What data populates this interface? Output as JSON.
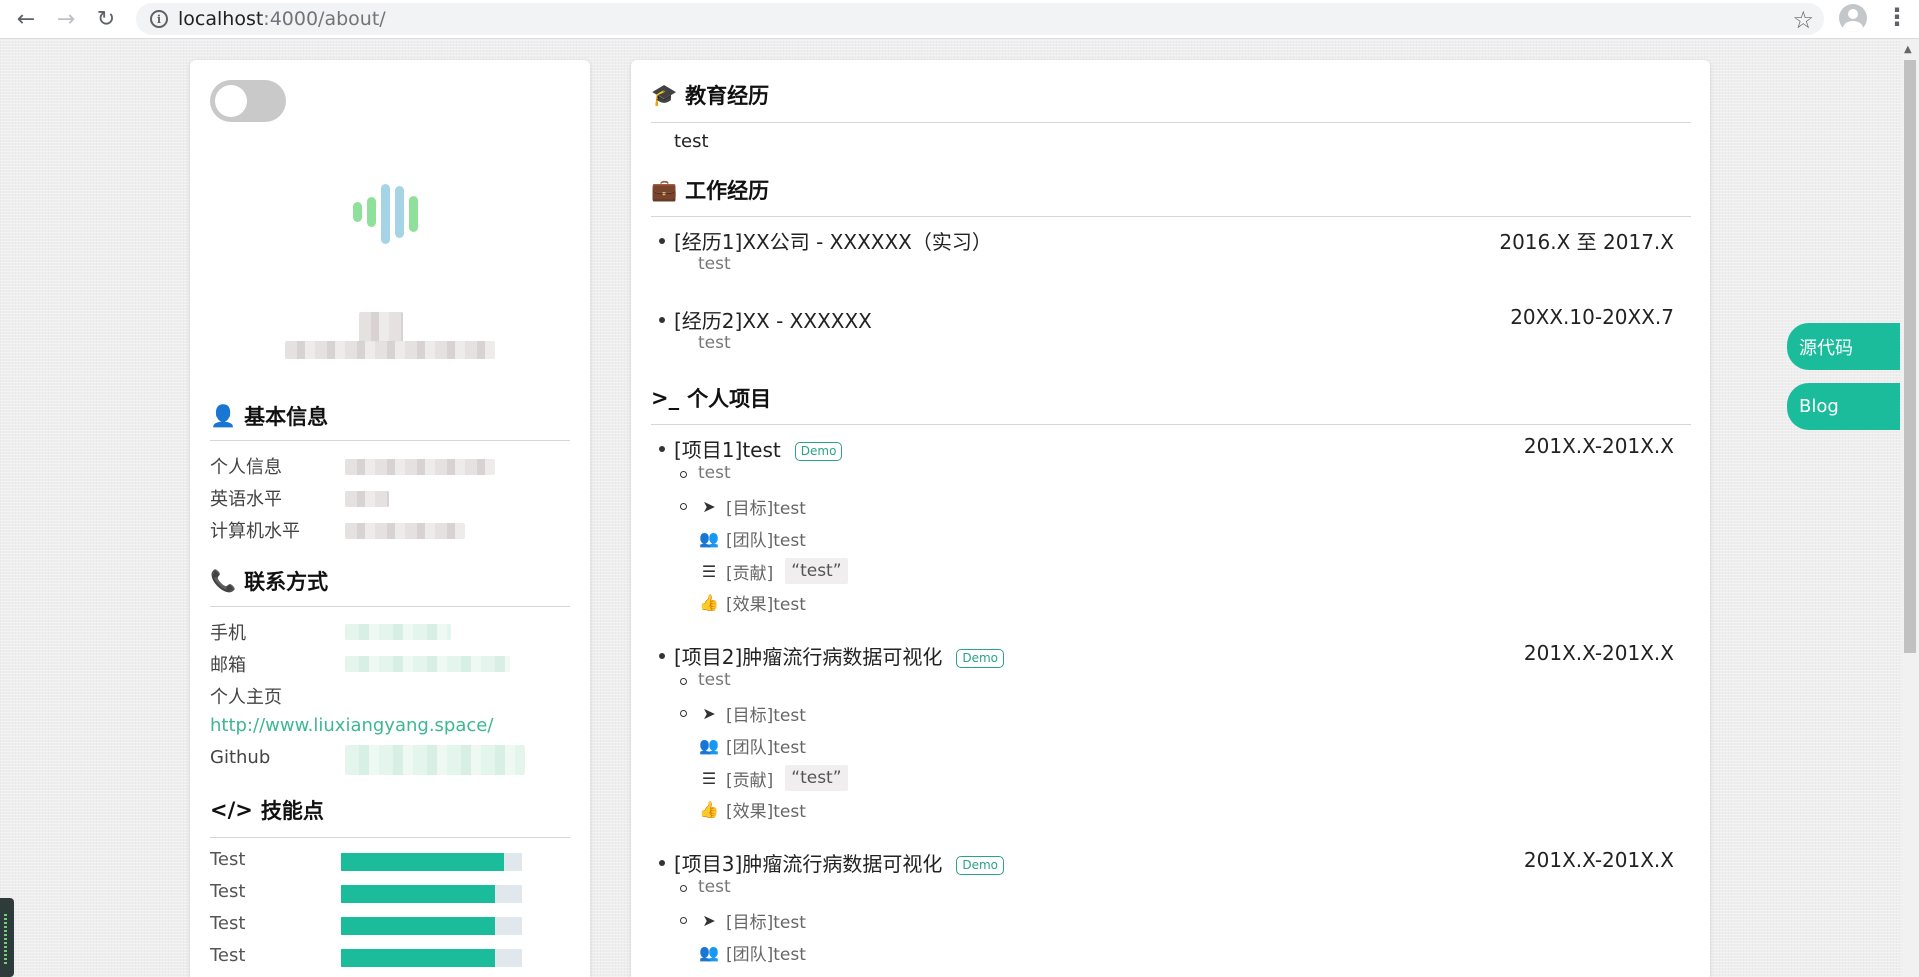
{
  "browser": {
    "url_host": "localhost",
    "url_path": ":4000/about/"
  },
  "sidebar": {
    "basic_info": {
      "title": "基本信息",
      "labels": [
        "个人信息",
        "英语水平",
        "计算机水平"
      ]
    },
    "contact": {
      "title": "联系方式",
      "labels": [
        "手机",
        "邮箱",
        "个人主页"
      ],
      "homepage_link": "http://www.liuxiangyang.space/",
      "github_label": "Github"
    },
    "skills": {
      "title": "技能点",
      "items": [
        {
          "name": "Test",
          "level": 0.9
        },
        {
          "name": "Test",
          "level": 0.85
        },
        {
          "name": "Test",
          "level": 0.85
        },
        {
          "name": "Test",
          "level": 0.85
        }
      ]
    }
  },
  "main": {
    "education": {
      "title": "教育经历",
      "text": "test"
    },
    "work": {
      "title": "工作经历",
      "items": [
        {
          "title": "[经历1]XX公司 - XXXXXX（实习）",
          "date": "2016.X 至 2017.X",
          "desc": "test"
        },
        {
          "title": "[经历2]XX - XXXXXX",
          "date": "20XX.10-20XX.7",
          "desc": "test"
        }
      ]
    },
    "projects": {
      "title": "个人项目",
      "demo_label": "Demo",
      "items": [
        {
          "title": "[项目1]test",
          "date": "201X.X-201X.X",
          "desc": "test",
          "goal": "[目标]test",
          "team": "[团队]test",
          "contrib_label": "[贡献]",
          "contrib_code": "“test”",
          "effect": "[效果]test"
        },
        {
          "title": "[项目2]肿瘤流行病数据可视化",
          "date": "201X.X-201X.X",
          "desc": "test",
          "goal": "[目标]test",
          "team": "[团队]test",
          "contrib_label": "[贡献]",
          "contrib_code": "“test”",
          "effect": "[效果]test"
        },
        {
          "title": "[项目3]肿瘤流行病数据可视化",
          "date": "201X.X-201X.X",
          "desc": "test",
          "goal": "[目标]test",
          "team": "[团队]test"
        }
      ]
    }
  },
  "floating": {
    "source_label": "源代码",
    "blog_label": "Blog"
  },
  "colors": {
    "accent": "#1abc9c",
    "link": "#3cb891"
  }
}
